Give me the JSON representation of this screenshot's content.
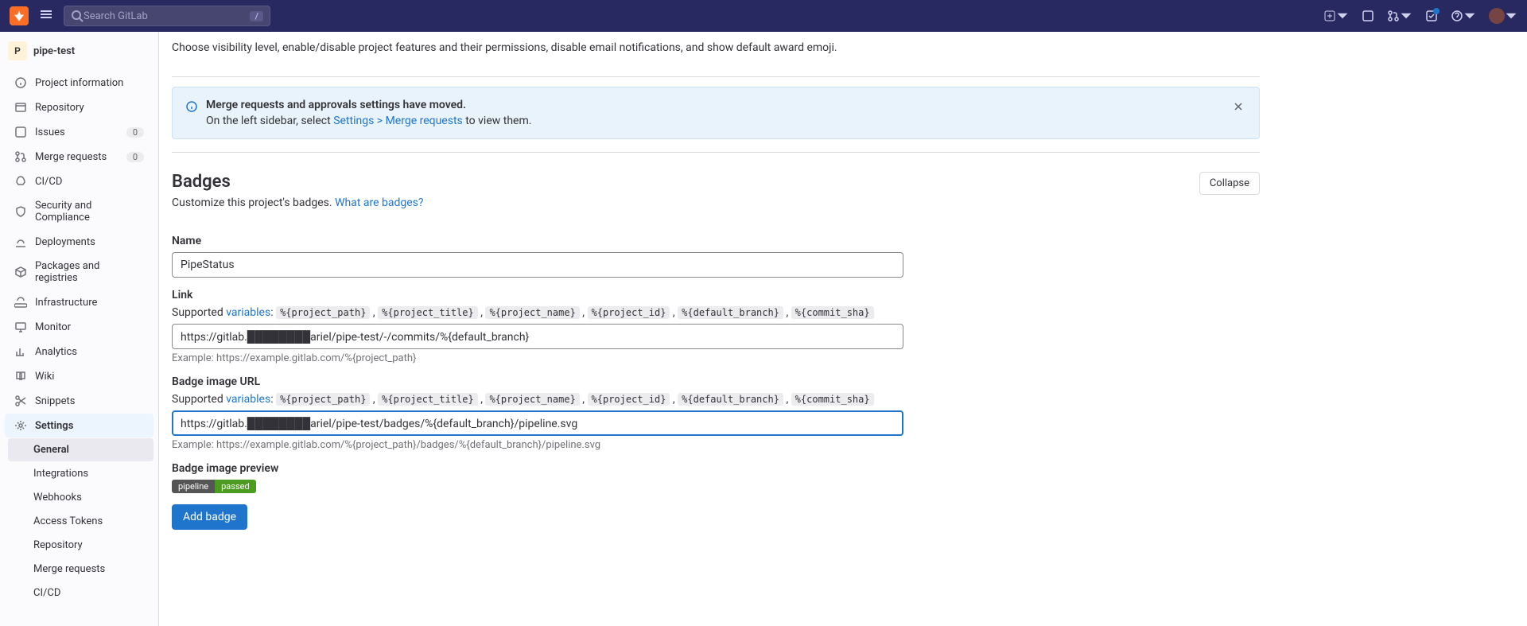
{
  "topbar": {
    "search_placeholder": "Search GitLab",
    "search_kbd": "/"
  },
  "project": {
    "avatar_letter": "P",
    "name": "pipe-test"
  },
  "sidebar": {
    "items": [
      {
        "label": "Project information"
      },
      {
        "label": "Repository"
      },
      {
        "label": "Issues",
        "badge": "0"
      },
      {
        "label": "Merge requests",
        "badge": "0"
      },
      {
        "label": "CI/CD"
      },
      {
        "label": "Security and Compliance"
      },
      {
        "label": "Deployments"
      },
      {
        "label": "Packages and registries"
      },
      {
        "label": "Infrastructure"
      },
      {
        "label": "Monitor"
      },
      {
        "label": "Analytics"
      },
      {
        "label": "Wiki"
      },
      {
        "label": "Snippets"
      },
      {
        "label": "Settings"
      }
    ],
    "sub_items": [
      {
        "label": "General"
      },
      {
        "label": "Integrations"
      },
      {
        "label": "Webhooks"
      },
      {
        "label": "Access Tokens"
      },
      {
        "label": "Repository"
      },
      {
        "label": "Merge requests"
      },
      {
        "label": "CI/CD"
      }
    ]
  },
  "intro": "Choose visibility level, enable/disable project features and their permissions, disable email notifications, and show default award emoji.",
  "alert": {
    "title": "Merge requests and approvals settings have moved.",
    "text_pre": "On the left sidebar, select ",
    "link": "Settings > Merge requests",
    "text_post": " to view them."
  },
  "badges": {
    "title": "Badges",
    "collapse": "Collapse",
    "desc_pre": "Customize this project's badges. ",
    "desc_link": "What are badges?",
    "name_label": "Name",
    "name_value": "PipeStatus",
    "link_label": "Link",
    "supported_pre": "Supported ",
    "supported_link": "variables",
    "supported_post": ": ",
    "vars": [
      "%{project_path}",
      "%{project_title}",
      "%{project_name}",
      "%{project_id}",
      "%{default_branch}",
      "%{commit_sha}"
    ],
    "link_value": "https://gitlab.████████ariel/pipe-test/-/commits/%{default_branch}",
    "link_example": "Example: https://example.gitlab.com/%{project_path}",
    "image_url_label": "Badge image URL",
    "image_url_value": "https://gitlab.████████ariel/pipe-test/badges/%{default_branch}/pipeline.svg",
    "image_url_example": "Example: https://example.gitlab.com/%{project_path}/badges/%{default_branch}/pipeline.svg",
    "preview_label": "Badge image preview",
    "preview_left": "pipeline",
    "preview_right": "passed",
    "add_button": "Add badge"
  }
}
